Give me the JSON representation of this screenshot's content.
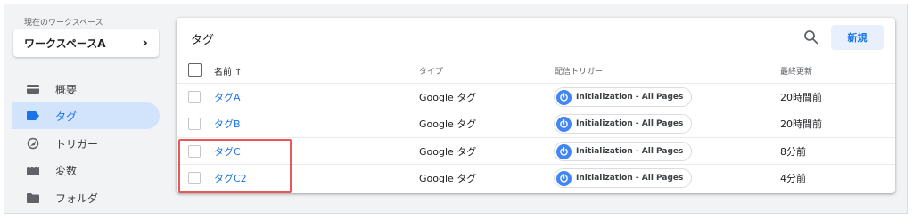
{
  "sidebar": {
    "workspace_caption": "現在のワークスペース",
    "workspace_name": "ワークスペースA",
    "items": [
      {
        "label": "概要",
        "icon": "overview-icon"
      },
      {
        "label": "タグ",
        "icon": "tag-icon",
        "active": true
      },
      {
        "label": "トリガー",
        "icon": "trigger-icon"
      },
      {
        "label": "変数",
        "icon": "variables-icon"
      },
      {
        "label": "フォルダ",
        "icon": "folder-icon"
      }
    ]
  },
  "main": {
    "title": "タグ",
    "new_button": "新規",
    "columns": {
      "name": "名前 ↑",
      "type": "タイプ",
      "trigger": "配信トリガー",
      "updated": "最終更新"
    },
    "rows": [
      {
        "name": "タグA",
        "type": "Google タグ",
        "trigger": "Initialization - All Pages",
        "updated": "20時間前"
      },
      {
        "name": "タグB",
        "type": "Google タグ",
        "trigger": "Initialization - All Pages",
        "updated": "20時間前"
      },
      {
        "name": "タグC",
        "type": "Google タグ",
        "trigger": "Initialization - All Pages",
        "updated": "8分前"
      },
      {
        "name": "タグC2",
        "type": "Google タグ",
        "trigger": "Initialization - All Pages",
        "updated": "4分前"
      }
    ]
  },
  "colors": {
    "accent": "#1a73e8",
    "active_nav_bg": "#d2e3fc",
    "highlight_box": "#e8585b",
    "trigger_icon": "#4285f4"
  }
}
